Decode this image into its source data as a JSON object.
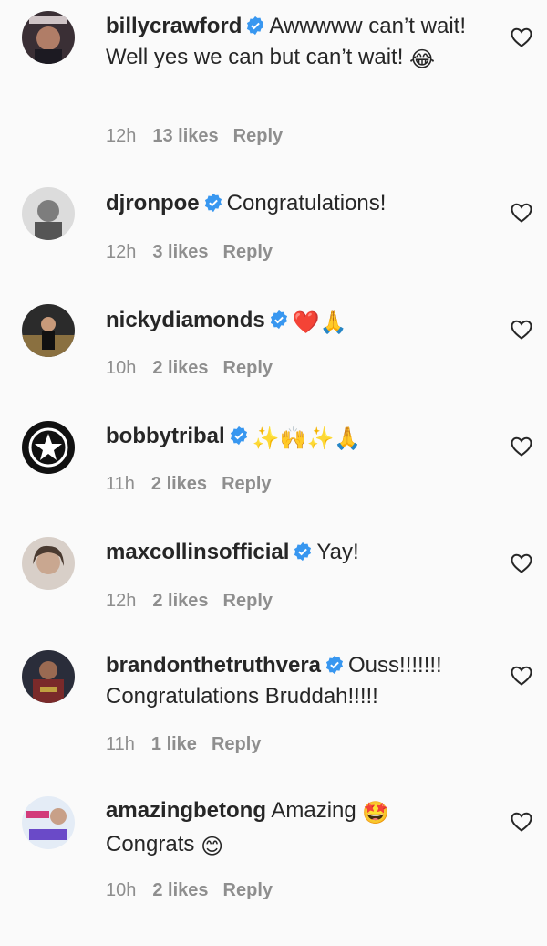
{
  "comments": [
    {
      "username": "billycrawford",
      "text": "Awwwww can’t wait! Well yes we can but can’t wait!",
      "emoji": "😂",
      "time": "12h",
      "likes": "13 likes",
      "reply": "Reply"
    },
    {
      "username": "djronpoe",
      "text": "Congratulations!",
      "emoji": "",
      "time": "12h",
      "likes": "3 likes",
      "reply": "Reply"
    },
    {
      "username": "nickydiamonds",
      "text": "",
      "emoji": "❤️🙏",
      "time": "10h",
      "likes": "2 likes",
      "reply": "Reply"
    },
    {
      "username": "bobbytribal",
      "text": "",
      "emoji": "✨🙌✨🙏",
      "time": "11h",
      "likes": "2 likes",
      "reply": "Reply"
    },
    {
      "username": "maxcollinsofficial",
      "text": "Yay!",
      "emoji": "",
      "time": "12h",
      "likes": "2 likes",
      "reply": "Reply"
    },
    {
      "username": "brandonthetruthvera",
      "text": "Ouss!!!!!!! Congratulations Bruddah!!!!!",
      "emoji": "",
      "time": "11h",
      "likes": "1 like",
      "reply": "Reply"
    },
    {
      "username": "amazingbetong",
      "text": "Amazing",
      "emoji": "🤩",
      "text2": "Congrats",
      "emoji2": "😊",
      "time": "10h",
      "likes": "2 likes",
      "reply": "Reply"
    }
  ],
  "colors": {
    "verified": "#3897f0",
    "meta": "#8e8e8e",
    "text": "#262626"
  }
}
